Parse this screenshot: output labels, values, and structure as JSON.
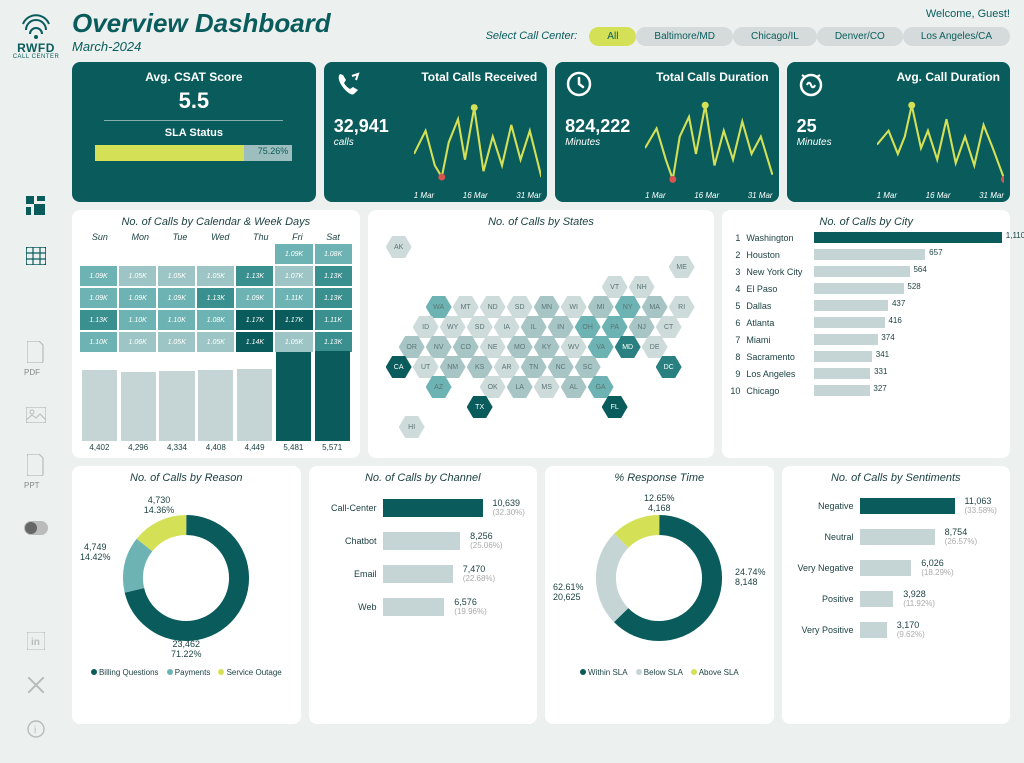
{
  "brand": {
    "name": "RWFD",
    "sub": "CALL CENTER"
  },
  "sidebar": {
    "nav": [
      {
        "name": "dashboard-icon"
      },
      {
        "name": "table-icon"
      }
    ],
    "export": [
      {
        "name": "pdf-icon",
        "label": "PDF"
      },
      {
        "name": "image-icon",
        "label": ""
      },
      {
        "name": "ppt-icon",
        "label": "PPT"
      }
    ],
    "social": [
      {
        "name": "linkedin-icon"
      },
      {
        "name": "x-icon"
      },
      {
        "name": "info-icon"
      }
    ]
  },
  "header": {
    "title": "Overview Dashboard",
    "subtitle": "March-2024",
    "welcome": "Welcome, Guest!",
    "filter_label": "Select Call Center:",
    "filters": [
      "All",
      "Baltimore/MD",
      "Chicago/IL",
      "Denver/CO",
      "Los Angeles/CA"
    ],
    "active_filter": "All"
  },
  "kpis": {
    "csat": {
      "title": "Avg. CSAT Score",
      "value": "5.5",
      "sla_label": "SLA Status",
      "sla_pct": 75.26,
      "sla_text": "75.26%"
    },
    "total_calls": {
      "title": "Total Calls Received",
      "value": "32,941",
      "unit": "calls"
    },
    "total_duration": {
      "title": "Total Calls Duration",
      "value": "824,222",
      "unit": "Minutes"
    },
    "avg_duration": {
      "title": "Avg. Call Duration",
      "value": "25",
      "unit": "Minutes"
    },
    "xlabels": [
      "1 Mar",
      "16 Mar",
      "31 Mar"
    ]
  },
  "calendar": {
    "title": "No. of Calls by Calendar & Week Days",
    "days": [
      "Sun",
      "Mon",
      "Tue",
      "Wed",
      "Thu",
      "Fri",
      "Sat"
    ],
    "cells": [
      "",
      "",
      "",
      "",
      "",
      "1.09K",
      "1.08K",
      "1.09K",
      "1.05K",
      "1.05K",
      "1.05K",
      "1.13K",
      "1.07K",
      "1.13K",
      "1.09K",
      "1.09K",
      "1.09K",
      "1.13K",
      "1.09K",
      "1.11K",
      "1.13K",
      "1.13K",
      "1.10K",
      "1.10K",
      "1.08K",
      "1.17K",
      "1.17K",
      "1.11K",
      "1.10K",
      "1.06K",
      "1.05K",
      "1.05K",
      "1.14K",
      "1.05K",
      "1.13K"
    ],
    "shades": [
      0,
      0,
      0,
      0,
      0,
      2,
      2,
      2,
      1,
      1,
      1,
      3,
      1,
      3,
      2,
      2,
      2,
      3,
      2,
      2,
      3,
      3,
      2,
      2,
      2,
      4,
      4,
      3,
      2,
      1,
      1,
      1,
      4,
      1,
      3
    ],
    "totals": [
      4402,
      4296,
      4334,
      4408,
      4449,
      5481,
      5571
    ],
    "total_labels": [
      "4,402",
      "4,296",
      "4,334",
      "4,408",
      "4,449",
      "5,481",
      "5,571"
    ]
  },
  "map": {
    "title": "No. of Calls by States"
  },
  "city": {
    "title": "No. of Calls by City",
    "rows": [
      {
        "rank": 1,
        "name": "Washington",
        "val": 1110,
        "label": "1,110"
      },
      {
        "rank": 2,
        "name": "Houston",
        "val": 657,
        "label": "657"
      },
      {
        "rank": 3,
        "name": "New York City",
        "val": 564,
        "label": "564"
      },
      {
        "rank": 4,
        "name": "El Paso",
        "val": 528,
        "label": "528"
      },
      {
        "rank": 5,
        "name": "Dallas",
        "val": 437,
        "label": "437"
      },
      {
        "rank": 6,
        "name": "Atlanta",
        "val": 416,
        "label": "416"
      },
      {
        "rank": 7,
        "name": "Miami",
        "val": 374,
        "label": "374"
      },
      {
        "rank": 8,
        "name": "Sacramento",
        "val": 341,
        "label": "341"
      },
      {
        "rank": 9,
        "name": "Los Angeles",
        "val": 331,
        "label": "331"
      },
      {
        "rank": 10,
        "name": "Chicago",
        "val": 327,
        "label": "327"
      }
    ]
  },
  "reason": {
    "title": "No. of Calls by Reason",
    "data": [
      {
        "name": "Billing Questions",
        "val": 23462,
        "pct": 71.22,
        "color": "#0a5c5c"
      },
      {
        "name": "Payments",
        "val": 4749,
        "pct": 14.42,
        "color": "#6eb3b3"
      },
      {
        "name": "Service Outage",
        "val": 4730,
        "pct": 14.36,
        "color": "#d4e157"
      }
    ]
  },
  "channel": {
    "title": "No. of Calls by Channel",
    "rows": [
      {
        "name": "Call-Center",
        "val": 10639,
        "label": "10,639",
        "pct": "(32.30%)",
        "color": "#0a5c5c"
      },
      {
        "name": "Chatbot",
        "val": 8256,
        "label": "8,256",
        "pct": "(25.06%)",
        "color": "#c5d4d4"
      },
      {
        "name": "Email",
        "val": 7470,
        "label": "7,470",
        "pct": "(22.68%)",
        "color": "#c5d4d4"
      },
      {
        "name": "Web",
        "val": 6576,
        "label": "6,576",
        "pct": "(19.96%)",
        "color": "#c5d4d4"
      }
    ]
  },
  "response": {
    "title": "% Response Time",
    "data": [
      {
        "name": "Within SLA",
        "val": 20625,
        "pct": 62.61,
        "color": "#0a5c5c"
      },
      {
        "name": "Below SLA",
        "val": 8148,
        "pct": 24.74,
        "color": "#c5d4d4"
      },
      {
        "name": "Above SLA",
        "val": 4168,
        "pct": 12.65,
        "color": "#d4e157"
      }
    ]
  },
  "sentiment": {
    "title": "No. of Calls by Sentiments",
    "rows": [
      {
        "name": "Negative",
        "val": 11063,
        "label": "11,063",
        "pct": "(33.58%)",
        "color": "#0a5c5c"
      },
      {
        "name": "Neutral",
        "val": 8754,
        "label": "8,754",
        "pct": "(26.57%)",
        "color": "#c5d4d4"
      },
      {
        "name": "Very Negative",
        "val": 6026,
        "label": "6,026",
        "pct": "(18.29%)",
        "color": "#c5d4d4"
      },
      {
        "name": "Positive",
        "val": 3928,
        "label": "3,928",
        "pct": "(11.92%)",
        "color": "#c5d4d4"
      },
      {
        "name": "Very Positive",
        "val": 3170,
        "label": "3,170",
        "pct": "(9.62%)",
        "color": "#c5d4d4"
      }
    ]
  },
  "chart_data": [
    {
      "type": "bar",
      "title": "Avg. CSAT Score / SLA Status",
      "value": 5.5,
      "sla_pct": 75.26
    },
    {
      "type": "line",
      "title": "Total Calls Received",
      "ylabel": "calls",
      "x": [
        "1 Mar",
        "16 Mar",
        "31 Mar"
      ],
      "total": 32941
    },
    {
      "type": "line",
      "title": "Total Calls Duration",
      "ylabel": "Minutes",
      "x": [
        "1 Mar",
        "16 Mar",
        "31 Mar"
      ],
      "total": 824222
    },
    {
      "type": "line",
      "title": "Avg. Call Duration",
      "ylabel": "Minutes",
      "x": [
        "1 Mar",
        "16 Mar",
        "31 Mar"
      ],
      "value": 25
    },
    {
      "type": "heatmap",
      "title": "No. of Calls by Calendar & Week Days",
      "categories": [
        "Sun",
        "Mon",
        "Tue",
        "Wed",
        "Thu",
        "Fri",
        "Sat"
      ],
      "totals": [
        4402,
        4296,
        4334,
        4408,
        4449,
        5481,
        5571
      ]
    },
    {
      "type": "bar",
      "title": "No. of Calls by City",
      "categories": [
        "Washington",
        "Houston",
        "New York City",
        "El Paso",
        "Dallas",
        "Atlanta",
        "Miami",
        "Sacramento",
        "Los Angeles",
        "Chicago"
      ],
      "values": [
        1110,
        657,
        564,
        528,
        437,
        416,
        374,
        341,
        331,
        327
      ]
    },
    {
      "type": "pie",
      "title": "No. of Calls by Reason",
      "series": [
        {
          "name": "Billing Questions",
          "value": 23462,
          "pct": 71.22
        },
        {
          "name": "Payments",
          "value": 4749,
          "pct": 14.42
        },
        {
          "name": "Service Outage",
          "value": 4730,
          "pct": 14.36
        }
      ]
    },
    {
      "type": "bar",
      "title": "No. of Calls by Channel",
      "categories": [
        "Call-Center",
        "Chatbot",
        "Email",
        "Web"
      ],
      "values": [
        10639,
        8256,
        7470,
        6576
      ]
    },
    {
      "type": "pie",
      "title": "% Response Time",
      "series": [
        {
          "name": "Within SLA",
          "value": 20625,
          "pct": 62.61
        },
        {
          "name": "Below SLA",
          "value": 8148,
          "pct": 24.74
        },
        {
          "name": "Above SLA",
          "value": 4168,
          "pct": 12.65
        }
      ]
    },
    {
      "type": "bar",
      "title": "No. of Calls by Sentiments",
      "categories": [
        "Negative",
        "Neutral",
        "Very Negative",
        "Positive",
        "Very Positive"
      ],
      "values": [
        11063,
        8754,
        6026,
        3928,
        3170
      ]
    }
  ]
}
